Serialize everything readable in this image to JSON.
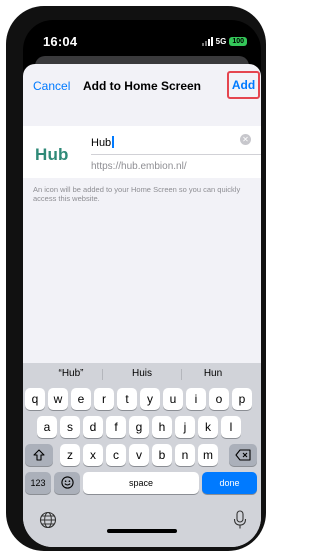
{
  "status_bar": {
    "time": "16:04",
    "network": "5G",
    "battery": "100"
  },
  "nav": {
    "cancel": "Cancel",
    "title": "Add to Home Screen",
    "add": "Add"
  },
  "shortcut": {
    "logo": "Hub",
    "name": "Hub",
    "url": "https://hub.embion.nl/"
  },
  "hint": "An icon will be added to your Home Screen so you can quickly access this website.",
  "keyboard": {
    "predictions": [
      "“Hub”",
      "Huis",
      "Hun"
    ],
    "row1": [
      "q",
      "w",
      "e",
      "r",
      "t",
      "y",
      "u",
      "i",
      "o",
      "p"
    ],
    "row2": [
      "a",
      "s",
      "d",
      "f",
      "g",
      "h",
      "j",
      "k",
      "l"
    ],
    "row3": [
      "z",
      "x",
      "c",
      "v",
      "b",
      "n",
      "m"
    ],
    "numbers": "123",
    "space": "space",
    "done": "done",
    "icons": [
      "shift-icon",
      "backspace-icon",
      "emoji-icon",
      "globe-icon",
      "mic-icon"
    ]
  },
  "colors": {
    "accent": "#007aff",
    "highlight": "#e5454f",
    "logo": "#2f8a78",
    "done": "#007aff"
  }
}
